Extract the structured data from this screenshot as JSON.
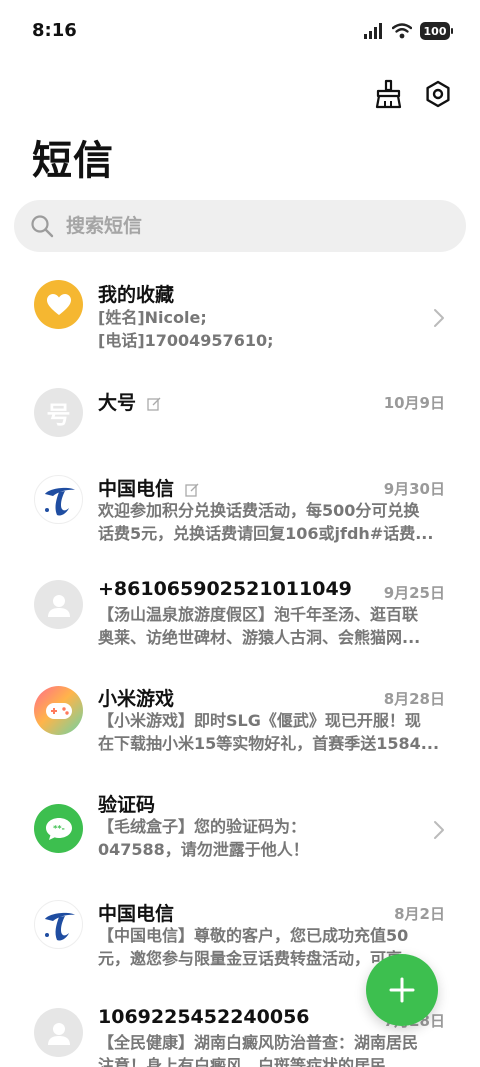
{
  "status_bar": {
    "time": "8:16",
    "battery": "100"
  },
  "title": "短信",
  "search": {
    "placeholder": "搜索短信"
  },
  "conversations": [
    {
      "title": "我的收藏",
      "date": "",
      "line1": "[姓名]Nicole;",
      "line2": "[电话]17004957610;",
      "avatar": "heart",
      "avatar_color": "#f5b731"
    },
    {
      "title": "大号",
      "date": "10月9日",
      "line1": "",
      "line2": "",
      "avatar": "text",
      "avatar_text": "号",
      "avatar_color": "#e6e6e6"
    },
    {
      "title": "中国电信",
      "date": "9月30日",
      "line1": "欢迎参加积分兑换话费活动，每500分可兑换",
      "line2": "话费5元，兑换话费请回复106或jfdh#话费...",
      "avatar": "telecom",
      "avatar_color": "#ffffff"
    },
    {
      "title": "+8610659025210110​49",
      "date": "9月25日",
      "line1": "【汤山温泉旅游度假区】泡千年圣汤、逛百联",
      "line2": "奥莱、访绝世碑材、游猿人古洞、会熊猫网...",
      "avatar": "person",
      "avatar_color": "#e6e6e6"
    },
    {
      "title": "小米游戏",
      "date": "8月28日",
      "line1": "【小米游戏】即时SLG《偃武》现已开服！现",
      "line2": "在下载抽小米15等实物好礼，首赛季送1584...",
      "avatar": "game",
      "avatar_color": "#ff8a5c"
    },
    {
      "title": "验证码",
      "date": "",
      "line1": "【毛绒盒子】您的验证码为：",
      "line2": "047588，请勿泄露于他人！",
      "avatar": "chat",
      "avatar_color": "#3dbf4f"
    },
    {
      "title": "中国电信",
      "date": "8月2日",
      "line1": "【中国电信】尊敬的客户，您已成功充值50",
      "line2": "元，邀您参与限量金豆话费转盘活动，可享...",
      "avatar": "telecom",
      "avatar_color": "#ffffff"
    },
    {
      "title": "1069225452240056",
      "date": "7月28日",
      "line1": "【全民健康】湖南白癜风防治普查：湖南居民",
      "line2": "注意！身上有白癜风、白斑等症状的居民...",
      "avatar": "person",
      "avatar_color": "#e6e6e6"
    }
  ],
  "colors": {
    "accent": "#3dbf4f",
    "favorite": "#f5b731",
    "telecom_blue": "#1f4da1"
  },
  "icons": [
    "broom-icon",
    "settings-icon",
    "search-icon",
    "chevron-right-icon",
    "plus-icon"
  ]
}
